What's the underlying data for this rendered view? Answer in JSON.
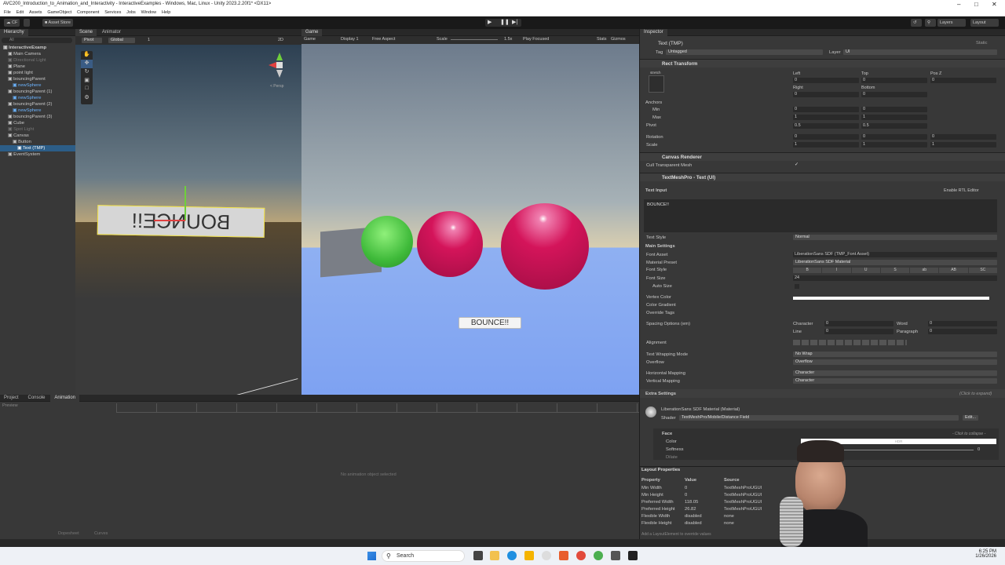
{
  "window": {
    "title": "AVC200_Introduction_to_Animation_and_Interactivity - InteractiveExamples - Windows, Mac, Linux - Unity 2023.2.20f1* <DX11>"
  },
  "menu": [
    "File",
    "Edit",
    "Assets",
    "GameObject",
    "Component",
    "Services",
    "Jobs",
    "Window",
    "Help"
  ],
  "toolbar": {
    "account": "CF",
    "asset_store": "Asset Store",
    "layers": "Layers",
    "layout": "Layout"
  },
  "hierarchy": {
    "tab": "Hierarchy",
    "search_placeholder": "All",
    "items": [
      {
        "label": "InteractiveExamp",
        "indent": 0,
        "style": "bold"
      },
      {
        "label": "Main Camera",
        "indent": 1,
        "style": ""
      },
      {
        "label": "Directional Light",
        "indent": 1,
        "style": "dim"
      },
      {
        "label": "Plane",
        "indent": 1,
        "style": ""
      },
      {
        "label": "point light",
        "indent": 1,
        "style": ""
      },
      {
        "label": "bouncingParent",
        "indent": 1,
        "style": ""
      },
      {
        "label": "newSphere",
        "indent": 2,
        "style": "blue"
      },
      {
        "label": "bouncingParent (1)",
        "indent": 1,
        "style": ""
      },
      {
        "label": "newSphere",
        "indent": 2,
        "style": "blue"
      },
      {
        "label": "bouncingParent (2)",
        "indent": 1,
        "style": ""
      },
      {
        "label": "newSphere",
        "indent": 2,
        "style": "blue"
      },
      {
        "label": "bouncingParent (3)",
        "indent": 1,
        "style": ""
      },
      {
        "label": "Cube",
        "indent": 1,
        "style": ""
      },
      {
        "label": "Spot Light",
        "indent": 1,
        "style": "dim"
      },
      {
        "label": "Canvas",
        "indent": 1,
        "style": ""
      },
      {
        "label": "Button",
        "indent": 2,
        "style": ""
      },
      {
        "label": "Text (TMP)",
        "indent": 3,
        "style": "sel"
      },
      {
        "label": "EventSystem",
        "indent": 1,
        "style": ""
      }
    ]
  },
  "scene": {
    "tabs": [
      "Scene",
      "Animator"
    ],
    "pivot": "Pivot",
    "global": "Global",
    "num": "1",
    "mode2d": "2D",
    "persp": "< Persp",
    "text": "BOUNCE!!"
  },
  "game": {
    "tab": "Game",
    "mode": "Game",
    "display": "Display 1",
    "aspect": "Free Aspect",
    "scale_label": "Scale",
    "scale_value": "1.5x",
    "play_focused": "Play Focused",
    "stats": "Stats",
    "gizmos": "Gizmos",
    "button_text": "BOUNCE!!"
  },
  "bottom": {
    "tabs": [
      "Project",
      "Console",
      "Animation"
    ],
    "preview": "Preview",
    "empty": "No animation object selected",
    "dopesheet": "Dopesheet",
    "curves": "Curves"
  },
  "inspector": {
    "tab": "Inspector",
    "object_name": "Text (TMP)",
    "static": "Static",
    "tag_label": "Tag",
    "tag": "Untagged",
    "layer_label": "Layer",
    "layer": "UI",
    "rect": {
      "title": "Rect Transform",
      "stretch": "stretch",
      "left_label": "Left",
      "left": "0",
      "top_label": "Top",
      "top": "0",
      "posz_label": "Pos Z",
      "posz": "0",
      "right_label": "Right",
      "right": "0",
      "bottom_label": "Bottom",
      "bottom": "0",
      "anchors": "Anchors",
      "min": "Min",
      "max": "Max",
      "pivot": "Pivot",
      "rotation": "Rotation",
      "scale": "Scale",
      "min_x": "0",
      "min_y": "0",
      "max_x": "1",
      "max_y": "1",
      "pivot_x": "0.5",
      "pivot_y": "0.5",
      "rot_x": "0",
      "rot_y": "0",
      "rot_z": "0",
      "scale_x": "1",
      "scale_y": "1",
      "scale_z": "1"
    },
    "canvas_renderer": {
      "title": "Canvas Renderer",
      "cull": "Cull Transparent Mesh"
    },
    "tmp": {
      "title": "TextMeshPro - Text (UI)",
      "text_input": "Text Input",
      "rtl": "Enable RTL Editor",
      "text": "BOUNCE!!",
      "text_style_label": "Text Style",
      "text_style": "Normal",
      "main_settings": "Main Settings",
      "font_asset_label": "Font Asset",
      "font_asset": "LiberationSans SDF (TMP_Font Asset)",
      "material_preset_label": "Material Preset",
      "material_preset": "LiberationSans SDF Material",
      "font_style_label": "Font Style",
      "font_styles": [
        "B",
        "I",
        "U",
        "S",
        "ab",
        "AB",
        "SC"
      ],
      "font_size_label": "Font Size",
      "font_size": "24",
      "auto_size": "Auto Size",
      "vertex_color": "Vertex Color",
      "color_gradient": "Color Gradient",
      "override_tags": "Override Tags",
      "spacing": "Spacing Options (em)",
      "character_label": "Character",
      "character": "0",
      "word_label": "Word",
      "word": "0",
      "line_label": "Line",
      "line": "0",
      "paragraph_label": "Paragraph",
      "paragraph": "0",
      "alignment": "Alignment",
      "wrapping_label": "Text Wrapping Mode",
      "wrapping": "No Wrap",
      "overflow_label": "Overflow",
      "overflow": "Overflow",
      "hmap_label": "Horizontal Mapping",
      "hmap": "Character",
      "vmap_label": "Vertical Mapping",
      "vmap": "Character",
      "extra": "Extra Settings",
      "click_expand": "(Click to expand)"
    },
    "material": {
      "title": "LiberationSans SDF Material (Material)",
      "shader_label": "Shader",
      "shader": "TextMeshPro/Mobile/Distance Field",
      "edit": "Edit...",
      "face": "Face",
      "collapse": "- Click to collapse -",
      "color": "Color",
      "hdr": "HDR",
      "softness": "Softness",
      "softness_val": "0",
      "dilate": "Dilate"
    },
    "layout": {
      "title": "Layout Properties",
      "headers": [
        "Property",
        "Value",
        "Source"
      ],
      "rows": [
        [
          "Min Width",
          "0",
          "TextMeshProUGUI"
        ],
        [
          "Min Height",
          "0",
          "TextMeshProUGUI"
        ],
        [
          "Preferred Width",
          "118.05",
          "TextMeshProUGUI"
        ],
        [
          "Preferred Height",
          "26.82",
          "TextMeshProUGUI"
        ],
        [
          "Flexible Width",
          "disabled",
          "none"
        ],
        [
          "Flexible Height",
          "disabled",
          "none"
        ]
      ],
      "footer": "Add a LayoutElement to override values"
    }
  },
  "taskbar": {
    "search": "Search",
    "time": "6:25 PM",
    "date": "1/26/2026"
  },
  "colors": {
    "selection": "#2c5d87",
    "sphere": "#d4145a",
    "green": "#39c13a",
    "floor": "#7fa3f0"
  }
}
